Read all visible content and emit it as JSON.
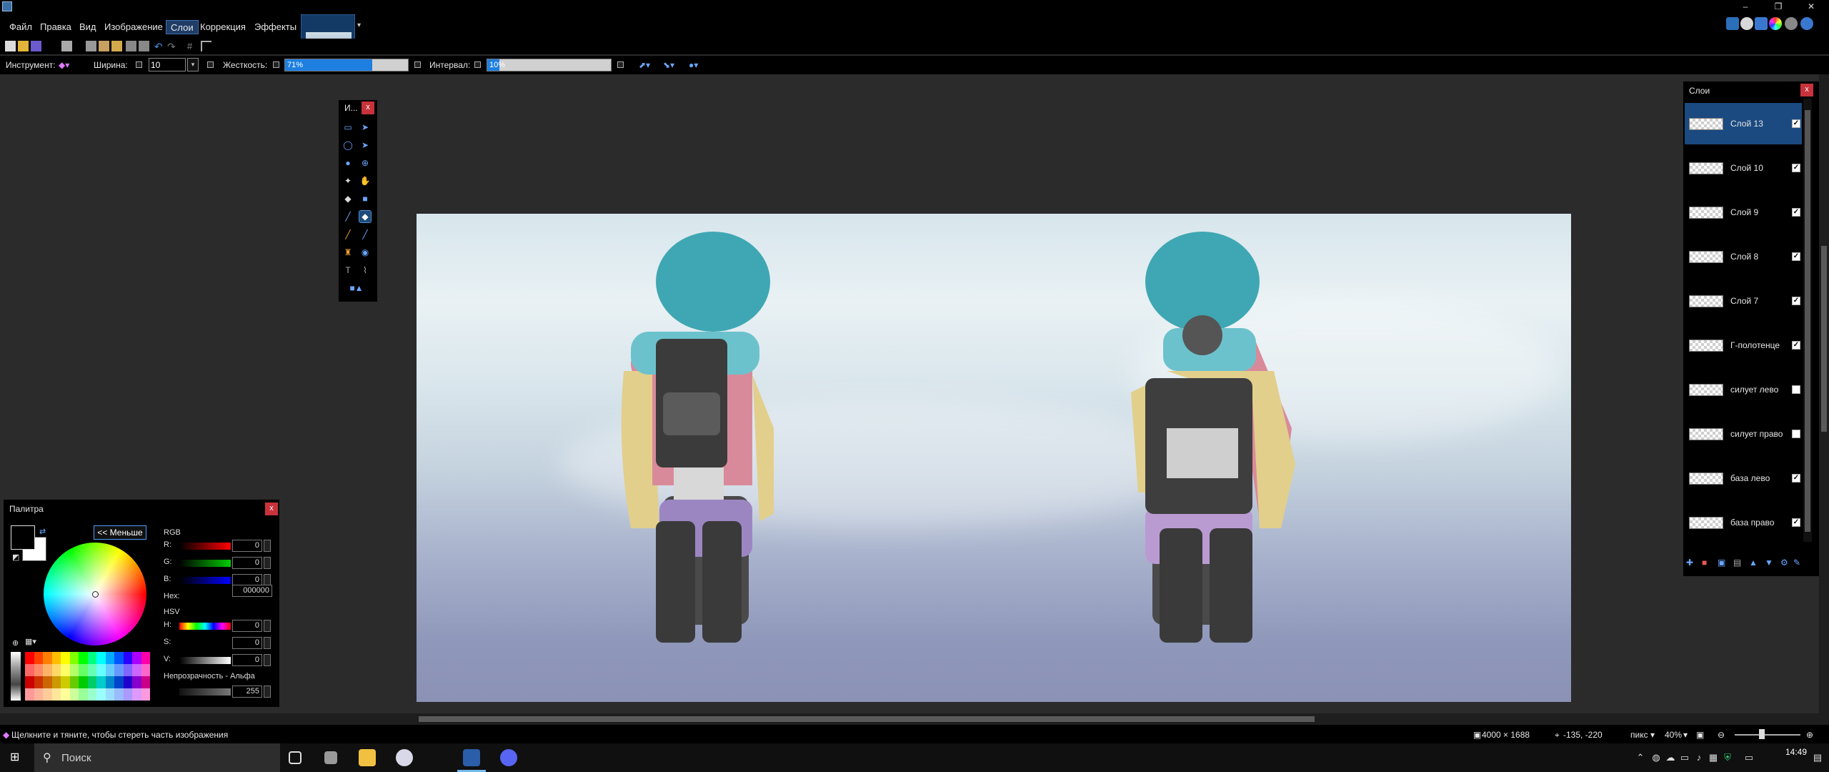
{
  "menu": {
    "items": [
      "Файл",
      "Правка",
      "Вид",
      "Изображение",
      "Слои",
      "Коррекция",
      "Эффекты"
    ],
    "active_index": 4
  },
  "options": {
    "tool_label": "Инструмент:",
    "width_label": "Ширина:",
    "width_value": "10",
    "hardness_label": "Жесткость:",
    "hardness_value": "71%",
    "hardness_fraction": 0.71,
    "interval_label": "Интервал:",
    "interval_value": "10%",
    "interval_fraction": 0.1
  },
  "tools_panel": {
    "title": "И...",
    "close": "x"
  },
  "palette": {
    "title": "Палитра",
    "close": "x",
    "less_button": "<< Меньше",
    "rgb_label": "RGB",
    "r_label": "R:",
    "g_label": "G:",
    "b_label": "B:",
    "r_value": "0",
    "g_value": "0",
    "b_value": "0",
    "hex_label": "Hex:",
    "hex_value": "000000",
    "hsv_label": "HSV",
    "h_label": "H:",
    "s_label": "S:",
    "v_label": "V:",
    "h_value": "0",
    "s_value": "0",
    "v_value": "0",
    "opacity_label": "Непрозрачность - Альфа",
    "alpha_value": "255",
    "primary_color": "#000000",
    "secondary_color": "#ffffff"
  },
  "layers": {
    "title": "Слои",
    "close": "x",
    "items": [
      {
        "name": "Слой 13",
        "visible": true,
        "selected": true
      },
      {
        "name": "Слой 10",
        "visible": true,
        "selected": false
      },
      {
        "name": "Слой 9",
        "visible": true,
        "selected": false
      },
      {
        "name": "Слой 8",
        "visible": true,
        "selected": false
      },
      {
        "name": "Слой 7",
        "visible": true,
        "selected": false
      },
      {
        "name": "Г-полотенце",
        "visible": true,
        "selected": false
      },
      {
        "name": "силует лево",
        "visible": false,
        "selected": false
      },
      {
        "name": "силует право",
        "visible": false,
        "selected": false
      },
      {
        "name": "база лево",
        "visible": true,
        "selected": false
      },
      {
        "name": "база право",
        "visible": true,
        "selected": false
      }
    ]
  },
  "status": {
    "hint": "Щелкните и тяните, чтобы стереть часть изображения",
    "image_size": "4000 × 1688",
    "cursor_pos": "-135, -220",
    "units": "пикс",
    "zoom": "40%"
  },
  "taskbar": {
    "search_placeholder": "Поиск",
    "time": "14:49"
  },
  "colors": {
    "accent": "#1e7fe0",
    "selected_layer": "#1a4a80",
    "close_button": "#c8323b"
  }
}
